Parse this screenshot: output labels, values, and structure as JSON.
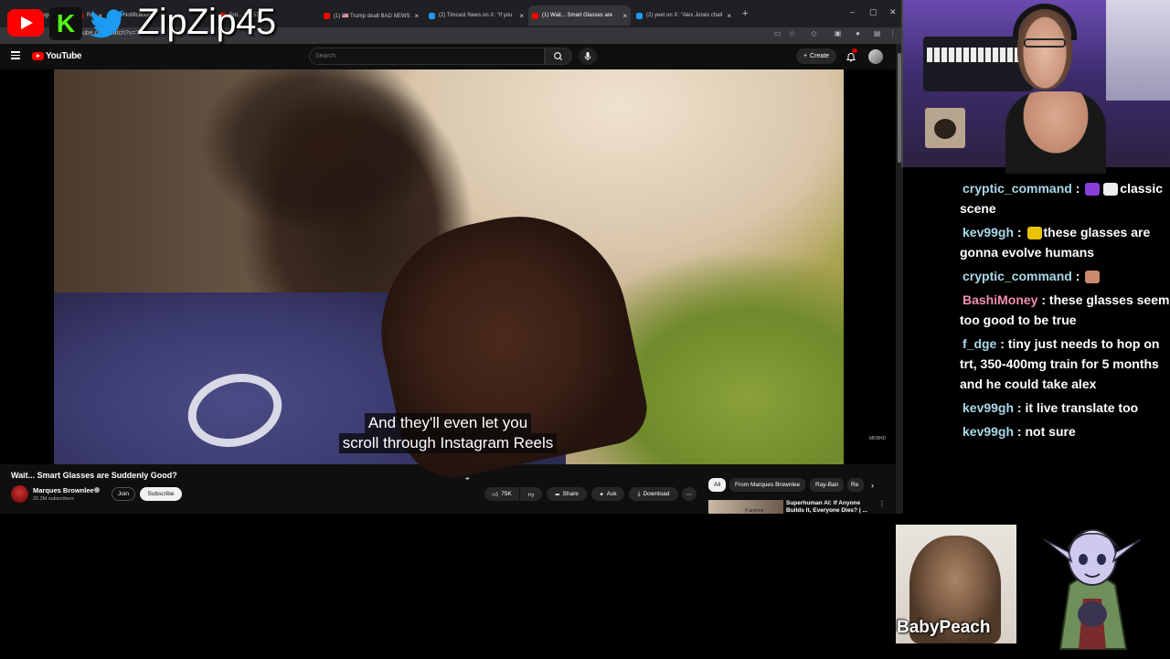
{
  "browser": {
    "tabs": [
      {
        "label": "(1) Dudebega...",
        "color": "#ff0000"
      },
      {
        "label": "Ru...",
        "color": "#ff0000"
      },
      {
        "label": "Notifications",
        "color": "#1d9bf0"
      },
      {
        "label": "Bot... 20757",
        "color": "#ff0000"
      },
      {
        "label": "(1) 🇺🇸 Trump dealt BAD NEWS",
        "color": "#ff0000"
      },
      {
        "label": "(2) Timcast News on X: \"If you",
        "color": "#1d9bf0"
      },
      {
        "label": "(1) Wait... Smart Glasses are",
        "color": "#ff0000"
      },
      {
        "label": "(2) yeet on X: \"Alex Jones chall",
        "color": "#1d9bf0"
      }
    ],
    "url": "tube.com/watch?v=7..."
  },
  "overlay": {
    "streamer_handle": "ZipZip45",
    "kick_letter": "K"
  },
  "youtube": {
    "logo_text": "YouTube",
    "search_placeholder": "Search",
    "create_label": "Create",
    "video": {
      "caption_line1": "And they'll even let you",
      "caption_line2": "scroll through Instagram Reels",
      "watermark": "MKBHD",
      "title": "Wait... Smart Glasses are Suddenly Good?"
    },
    "channel": {
      "name": "Marques Brownlee",
      "subscribers": "20.3M subscribers",
      "join_label": "Join",
      "subscribe_label": "Subscribe"
    },
    "actions": {
      "likes": "75K",
      "share_label": "Share",
      "ask_label": "Ask",
      "download_label": "Download"
    },
    "chips": [
      "All",
      "From Marques Brownlee",
      "Ray-Ban",
      "Re"
    ],
    "recommendation": {
      "thumb_text": "If anyone",
      "title": "Superhuman AI: If Anyone Builds It, Everyone Dies? | ..."
    }
  },
  "chat": [
    {
      "user": "cryptic_command",
      "color": "#a8d8e8",
      "emotes": [
        "#8b3fd9",
        "#eeeeee"
      ],
      "text": "classic scene"
    },
    {
      "user": "kev99gh",
      "color": "#a8d8e8",
      "emotes": [
        "#e6c200"
      ],
      "text": "these glasses are gonna evolve humans"
    },
    {
      "user": "cryptic_command",
      "color": "#a8d8e8",
      "emotes": [
        "#c98b6b"
      ],
      "text": ""
    },
    {
      "user": "BashiMoney",
      "color": "#f08fb0",
      "emotes": [],
      "text": "these glasses seem too good to be true"
    },
    {
      "user": "f_dge",
      "color": "#a8d8e8",
      "emotes": [],
      "text": "tiny just needs to hop on trt, 350-400mg train for 5 months and he could take alex"
    },
    {
      "user": "kev99gh",
      "color": "#a8d8e8",
      "emotes": [],
      "text": "it live translate too"
    },
    {
      "user": "kev99gh",
      "color": "#a8d8e8",
      "emotes": [],
      "text": "not sure"
    }
  ],
  "bottom": {
    "babypeach_label": "BabyPeach"
  }
}
